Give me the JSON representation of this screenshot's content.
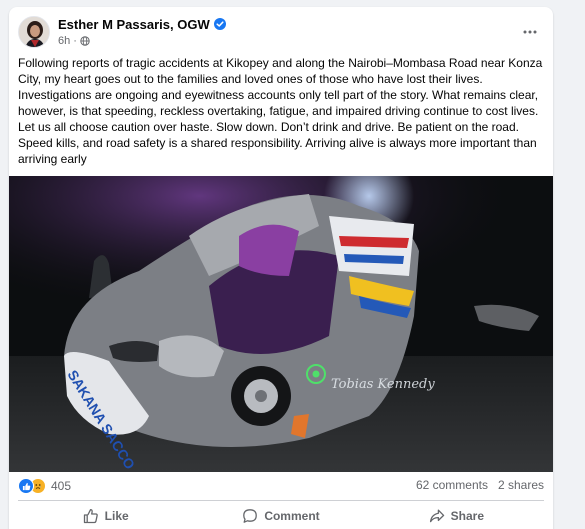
{
  "post": {
    "author": "Esther M Passaris, OGW",
    "time": "6h",
    "audience_icon": "globe-icon",
    "text": "Following reports of tragic accidents at Kikopey and along the Nairobi–Mombasa Road near Konza City, my heart goes out to the families and loved ones of those who have lost their lives. Investigations are ongoing and eyewitness accounts only tell part of the story. What remains clear, however, is that speeding, reckless overtaking, fatigue, and impaired driving continue to cost lives. Let us all choose caution over haste. Slow down. Don’t drink and drive. Be patient on the road. Speed kills, and road safety is a shared responsibility. Arriving alive is always more important than arriving early"
  },
  "photo": {
    "vehicle_text": "SAKANA SACCO",
    "watermark": "Tobias Kennedy"
  },
  "stats": {
    "reaction_icons": [
      "like-icon",
      "sad-icon"
    ],
    "reaction_count": "405",
    "comments": "62 comments",
    "shares": "2 shares"
  },
  "actions": {
    "like": "Like",
    "comment": "Comment",
    "share": "Share"
  },
  "colors": {
    "brand_blue": "#1877f2",
    "sad_yellow": "#f7b125",
    "secondary_text": "#65676b",
    "page_bg": "#f0f2f5"
  }
}
